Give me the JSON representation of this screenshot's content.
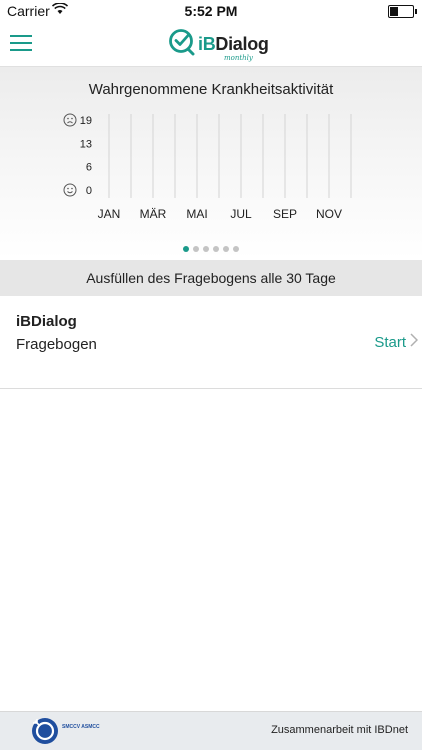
{
  "status": {
    "carrier": "Carrier",
    "time": "5:52 PM"
  },
  "app": {
    "logo_text_ib": "iB",
    "logo_text_rest": "Dialog",
    "logo_sub": "monthly",
    "accent": "#1a9a8a"
  },
  "chart": {
    "title": "Wahrgenommene Krankheitsaktivität",
    "pages": 6,
    "active_page": 0
  },
  "chart_data": {
    "type": "bar",
    "title": "Wahrgenommene Krankheitsaktivität",
    "categories": [
      "JAN",
      "",
      "MÄR",
      "",
      "MAI",
      "",
      "JUL",
      "",
      "SEP",
      "",
      "NOV",
      ""
    ],
    "x_labels": [
      "JAN",
      "MÄR",
      "MAI",
      "JUL",
      "SEP",
      "NOV"
    ],
    "y_ticks": [
      "19",
      "13",
      "6",
      "0"
    ],
    "ylim": [
      0,
      19
    ],
    "values": [],
    "grid": true
  },
  "section": {
    "header": "Ausfüllen des Fragebogens alle 30 Tage"
  },
  "questionnaire": {
    "title": "iBDialog",
    "subtitle": "Fragebogen",
    "action": "Start"
  },
  "footer": {
    "org": "SMCCV ASMCC",
    "collab": "Zusammenarbeit mit IBDnet"
  }
}
